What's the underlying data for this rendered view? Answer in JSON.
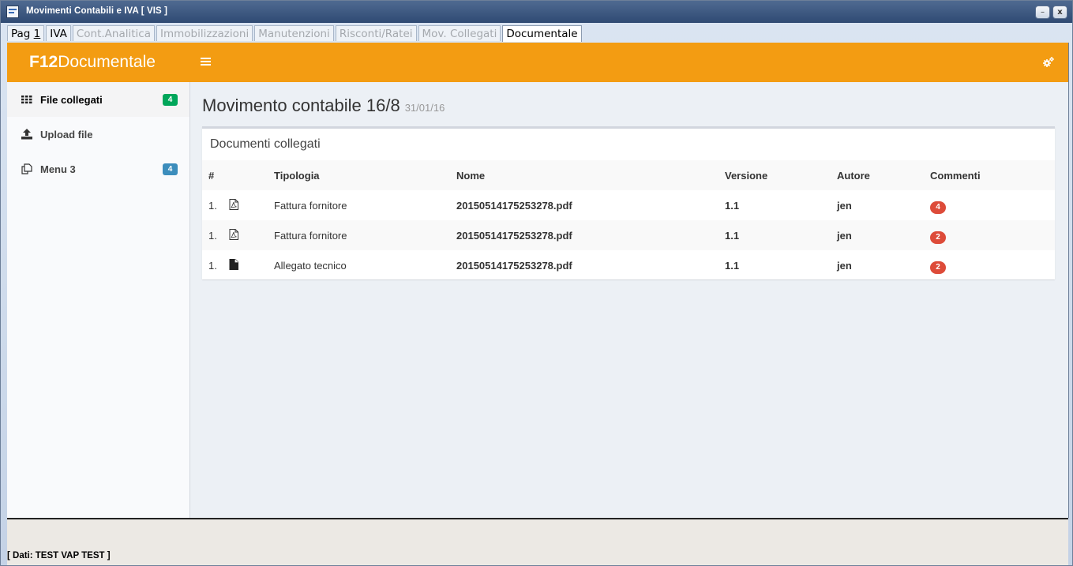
{
  "window": {
    "title": "Movimenti Contabili e IVA  [ VIS ]",
    "minimize_label": "–",
    "close_label": "x"
  },
  "tabs": [
    {
      "label_pre": "Pag ",
      "label_under": "1",
      "enabled": true,
      "active": false
    },
    {
      "label": "IVA",
      "enabled": true,
      "active": false
    },
    {
      "label": "Cont.Analitica",
      "enabled": false,
      "active": false
    },
    {
      "label": "Immobilizzazioni",
      "enabled": false,
      "active": false
    },
    {
      "label": "Manutenzioni",
      "enabled": false,
      "active": false
    },
    {
      "label": "Risconti/Ratei",
      "enabled": false,
      "active": false
    },
    {
      "label": "Mov. Collegati",
      "enabled": false,
      "active": false
    },
    {
      "label": "Documentale",
      "enabled": true,
      "active": true
    }
  ],
  "header": {
    "logo_bold": "F12",
    "logo_rest": "Documentale"
  },
  "sidebar": {
    "items": [
      {
        "label": "File collegati",
        "badge": "4",
        "badge_color": "#00a65a",
        "icon": "grid-icon"
      },
      {
        "label": "Upload file",
        "icon": "upload-icon"
      },
      {
        "label": "Menu 3",
        "badge": "4",
        "badge_color": "#3c8dbc",
        "icon": "copy-icon"
      }
    ]
  },
  "main": {
    "title": "Movimento contabile 16/8",
    "date": "31/01/16",
    "box_title": "Documenti collegati",
    "columns": [
      "#",
      "Tipologia",
      "Nome",
      "Versione",
      "Autore",
      "Commenti"
    ],
    "rows": [
      {
        "num": "1.",
        "icon": "file-pdf-icon",
        "tipologia": "Fattura fornitore",
        "nome": "20150514175253278.pdf",
        "versione": "1.1",
        "autore": "jen",
        "commenti": "4"
      },
      {
        "num": "1.",
        "icon": "file-pdf-icon",
        "tipologia": "Fattura fornitore",
        "nome": "20150514175253278.pdf",
        "versione": "1.1",
        "autore": "jen",
        "commenti": "2"
      },
      {
        "num": "1.",
        "icon": "file-icon",
        "tipologia": "Allegato tecnico",
        "nome": "20150514175253278.pdf",
        "versione": "1.1",
        "autore": "jen",
        "commenti": "2"
      }
    ]
  },
  "status": {
    "text": "[ Dati: TEST VAP TEST ]"
  },
  "colors": {
    "header": "#f39c12",
    "badge_red": "#dd4b39"
  }
}
